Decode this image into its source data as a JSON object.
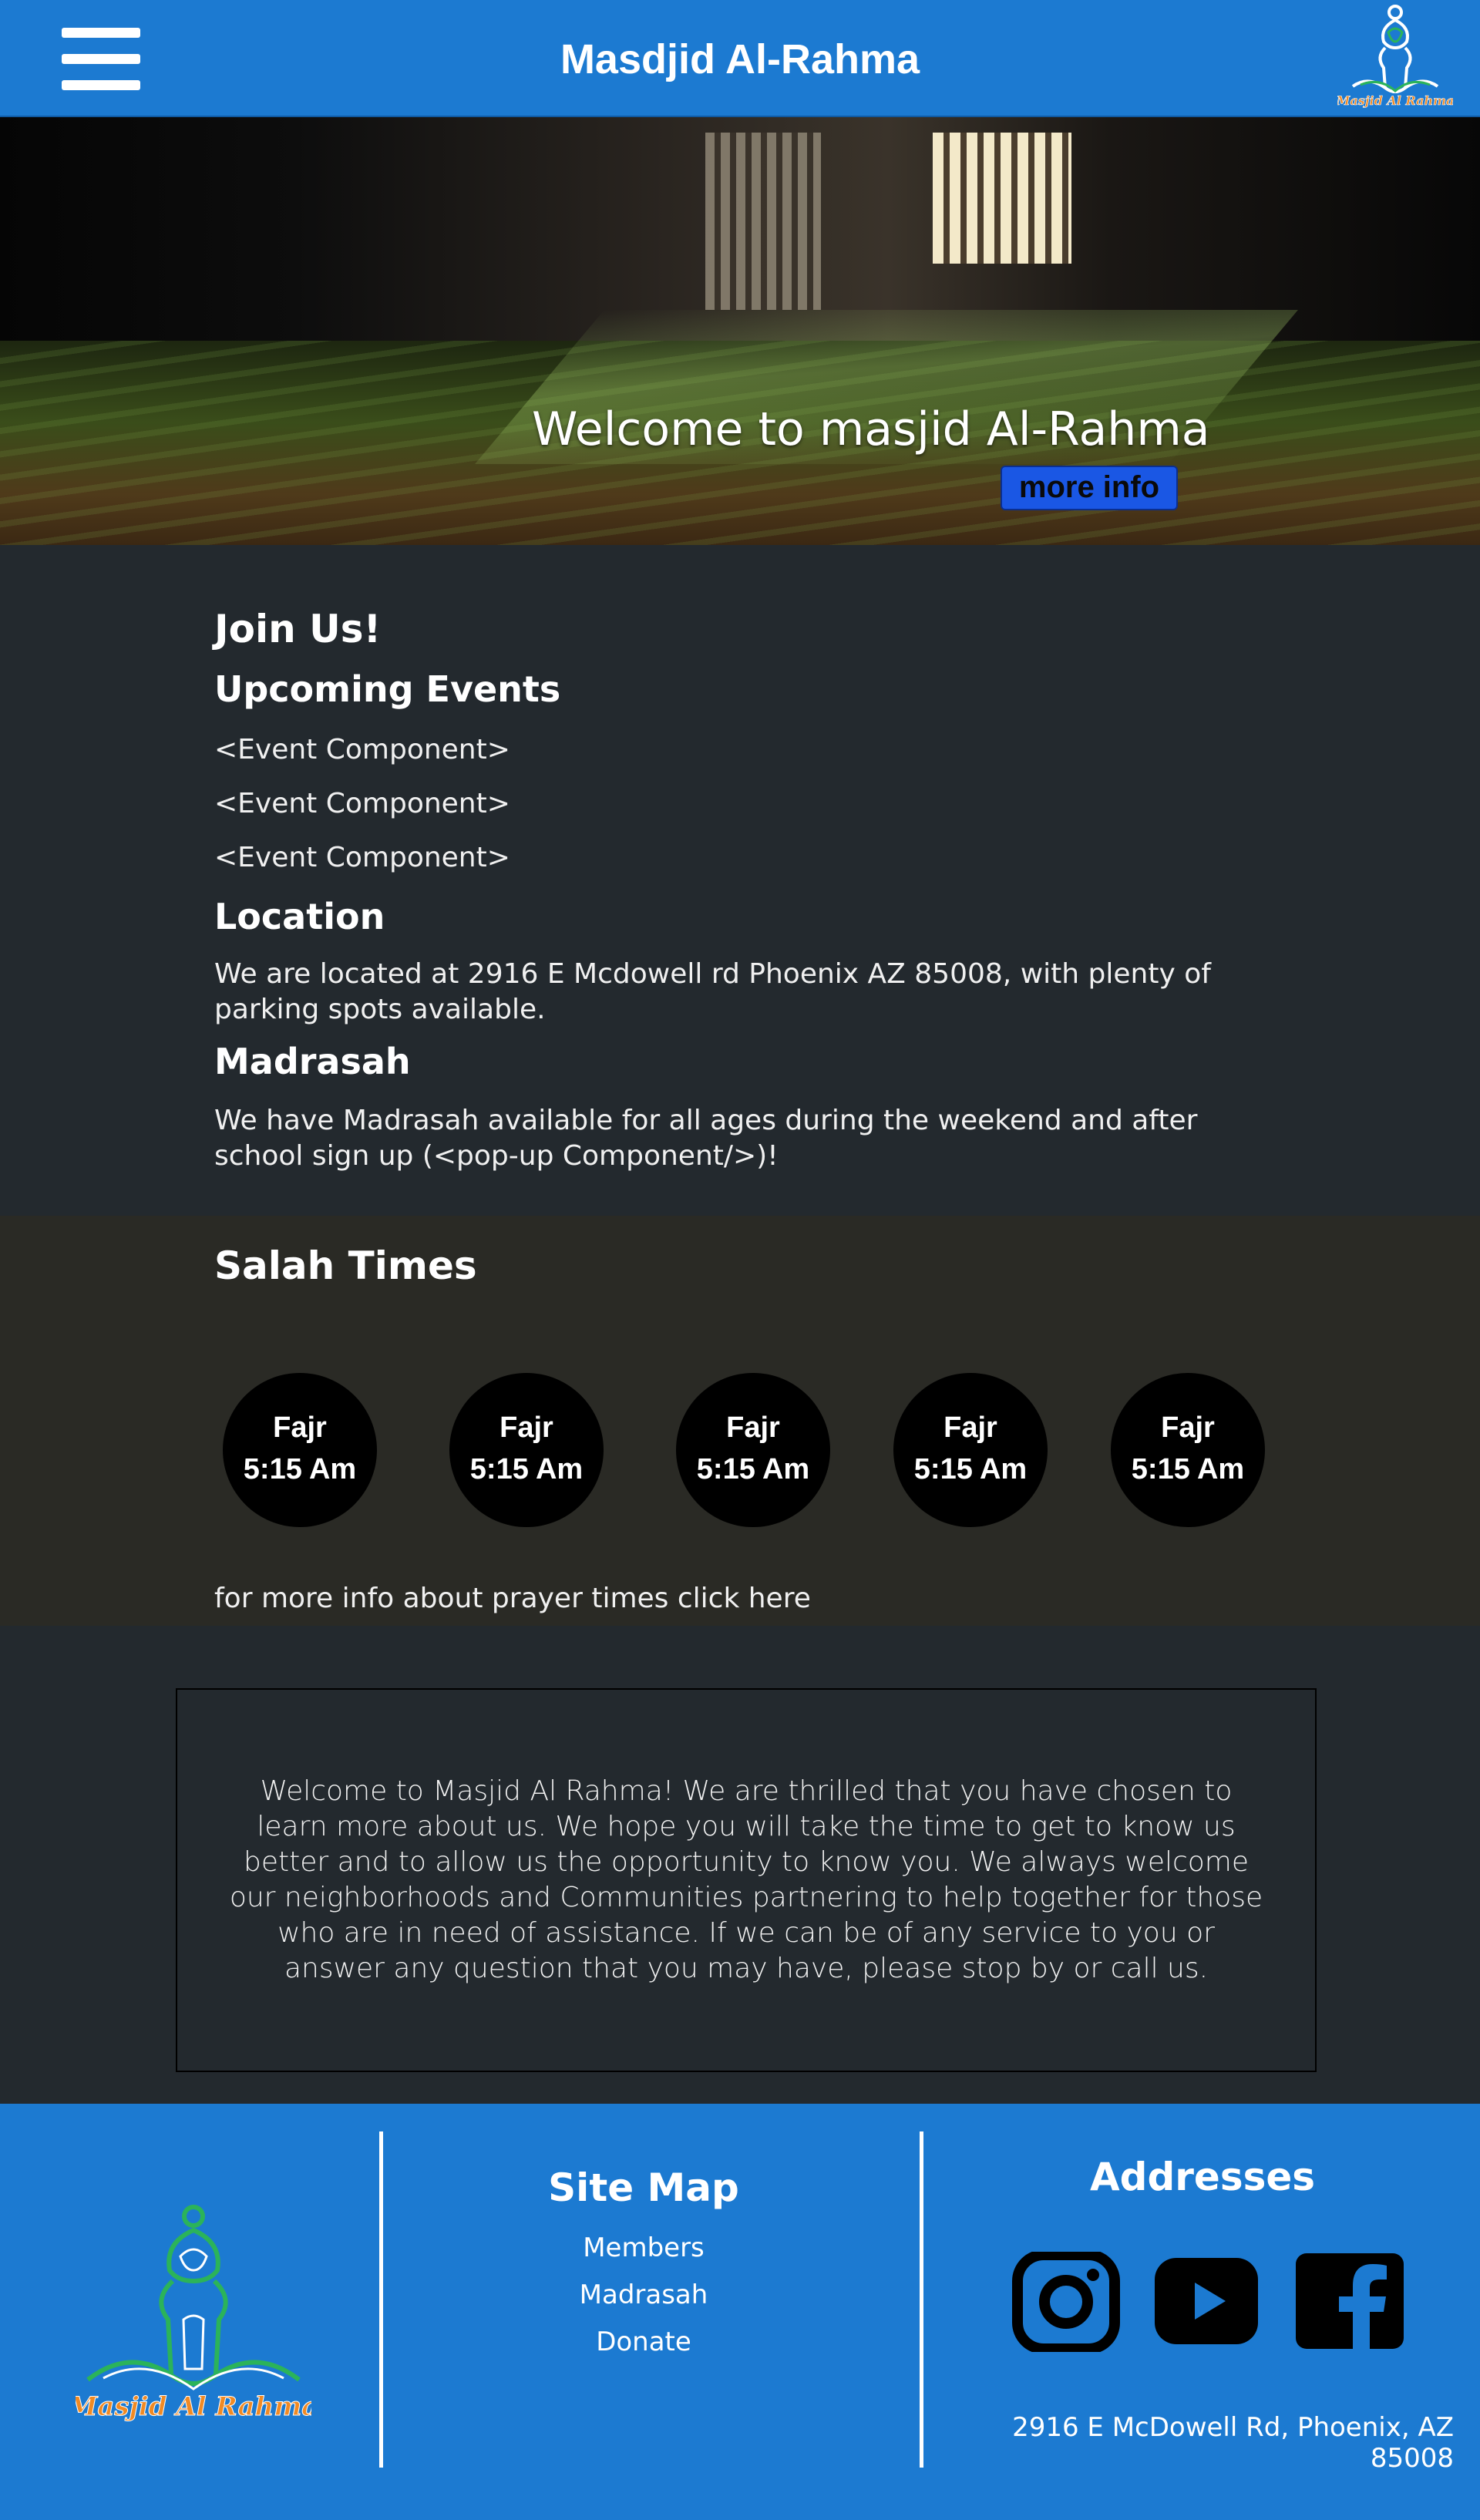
{
  "header": {
    "title": "Masdjid Al-Rahma",
    "menu_icon": "hamburger-menu-icon",
    "logo_text": "Masjid Al Rahma"
  },
  "hero": {
    "title": "Welcome to masjid Al-Rahma",
    "button_label": "more info"
  },
  "join": {
    "heading": "Join Us!",
    "events_heading": "Upcoming Events",
    "events": [
      "<Event Component>",
      "<Event Component>",
      "<Event Component>"
    ],
    "location_heading": "Location",
    "location_text": "We are located at 2916 E Mcdowell rd Phoenix AZ 85008, with plenty of parking spots available.",
    "madrasah_heading": "Madrasah",
    "madrasah_text": "We have Madrasah available for all ages during the weekend and after school sign up (<pop-up Component/>)!"
  },
  "salah": {
    "heading": "Salah Times",
    "prayers": [
      {
        "name": "Fajr",
        "time": "5:15 Am"
      },
      {
        "name": "Fajr",
        "time": "5:15 Am"
      },
      {
        "name": "Fajr",
        "time": "5:15 Am"
      },
      {
        "name": "Fajr",
        "time": "5:15 Am"
      },
      {
        "name": "Fajr",
        "time": "5:15 Am"
      }
    ],
    "more_info": "for more info about prayer times click here"
  },
  "welcome": {
    "text": "Welcome to Masjid Al Rahma! We are thrilled that you have chosen to learn more about us. We hope you will take the time to get to know us better and to allow us the opportunity to know you. We always welcome our neighborhoods and Communities partnering to help together for those who are in need of assistance. If we can be of any service to you or answer any question that you may have, please stop by or call us."
  },
  "footer": {
    "logo_text": "Masjid Al Rahma",
    "sitemap_title": "Site Map",
    "sitemap_items": [
      "Members",
      "Madrasah",
      "Donate"
    ],
    "addresses_title": "Addresses",
    "social_icons": [
      "instagram-icon",
      "youtube-icon",
      "facebook-icon"
    ],
    "address": "2916 E McDowell Rd, Phoenix, AZ 85008"
  },
  "colors": {
    "header_blue": "#1c7ad1",
    "dark_bg": "#23292e",
    "salah_bg": "#2a2a25",
    "button_blue": "#1a57e4",
    "logo_green": "#2bb35a",
    "logo_orange": "#f08a24"
  }
}
